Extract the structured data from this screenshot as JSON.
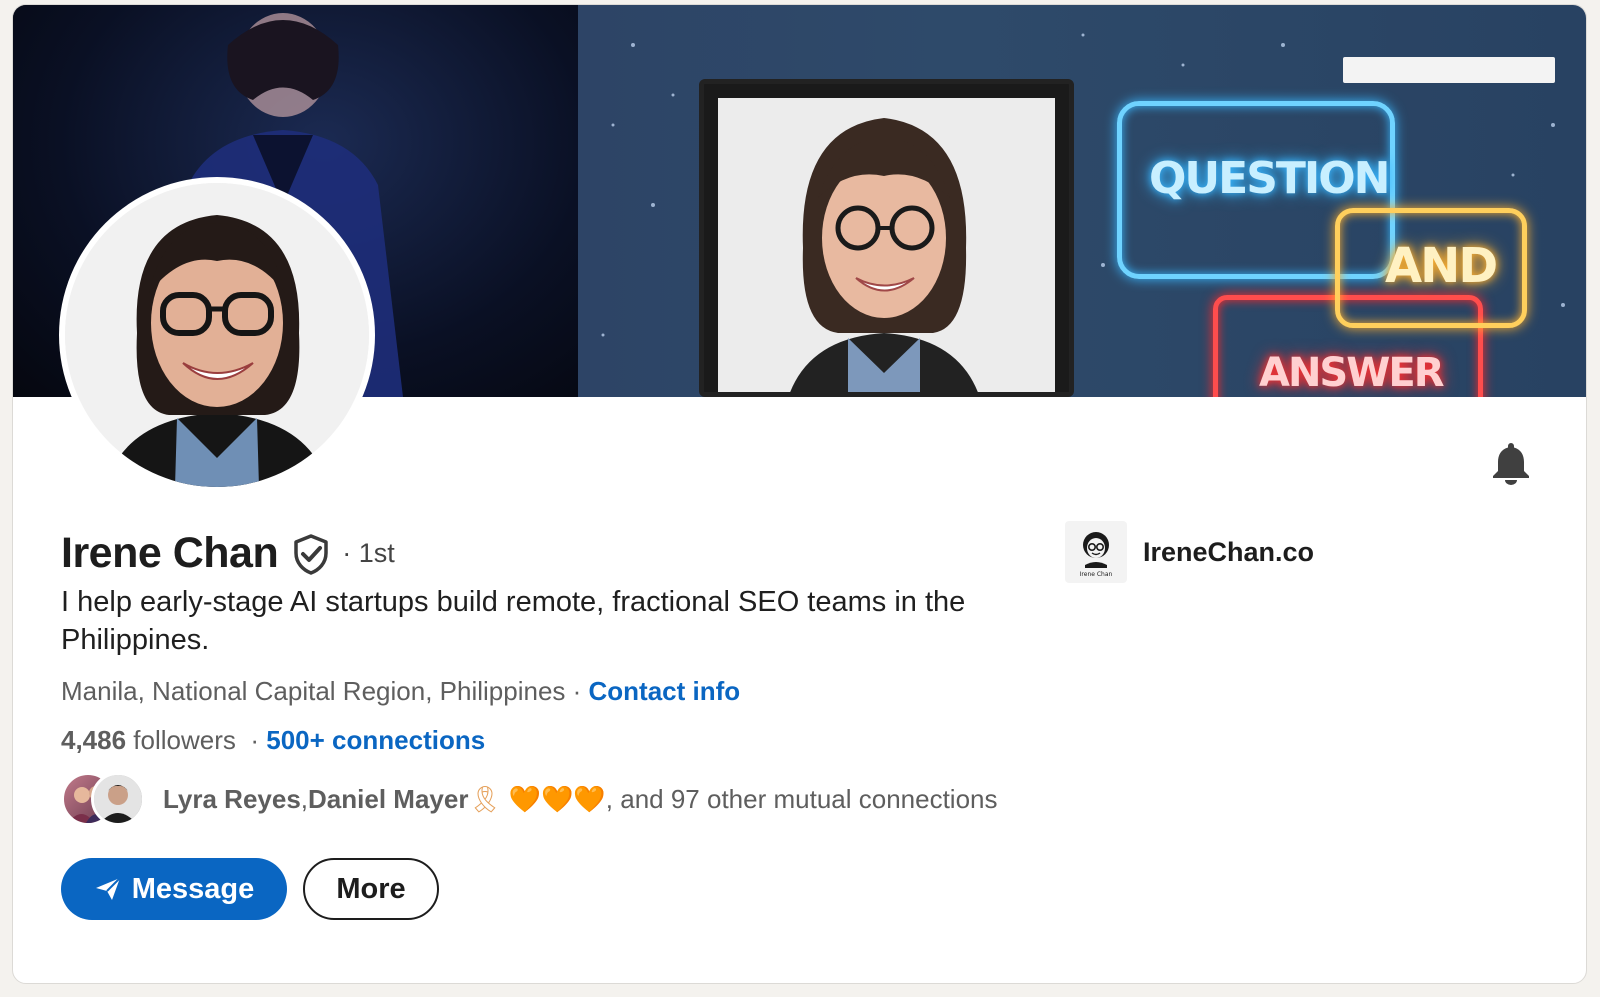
{
  "profile": {
    "name": "Irene Chan",
    "degree": "· 1st",
    "headline": "I help early-stage AI startups build remote, fractional SEO teams in the Philippines.",
    "location": "Manila, National Capital Region, Philippines",
    "location_sep": " · ",
    "contact_info_label": "Contact info",
    "followers_count": "4,486",
    "followers_label": " followers",
    "stats_sep": "  · ",
    "connections_label": "500+ connections"
  },
  "mutual": {
    "name1": "Lyra Reyes",
    "sep": ", ",
    "name2": "Daniel Mayer",
    "emoji": " 🎗 🧡🧡🧡",
    "rest": ", and 97 other mutual connections"
  },
  "banner": {
    "neon_question": "QUESTION",
    "neon_and": "AND",
    "neon_answer": "ANSWER"
  },
  "actions": {
    "message_label": "Message",
    "more_label": "More"
  },
  "company": {
    "name": "IreneChan.co",
    "logo_caption": "Irene Chan"
  },
  "colors": {
    "accent": "#0a66c2",
    "page_bg": "#f4f2ee"
  },
  "icons": {
    "verified": "verified-shield-icon",
    "bell": "bell-icon",
    "send": "send-icon"
  }
}
